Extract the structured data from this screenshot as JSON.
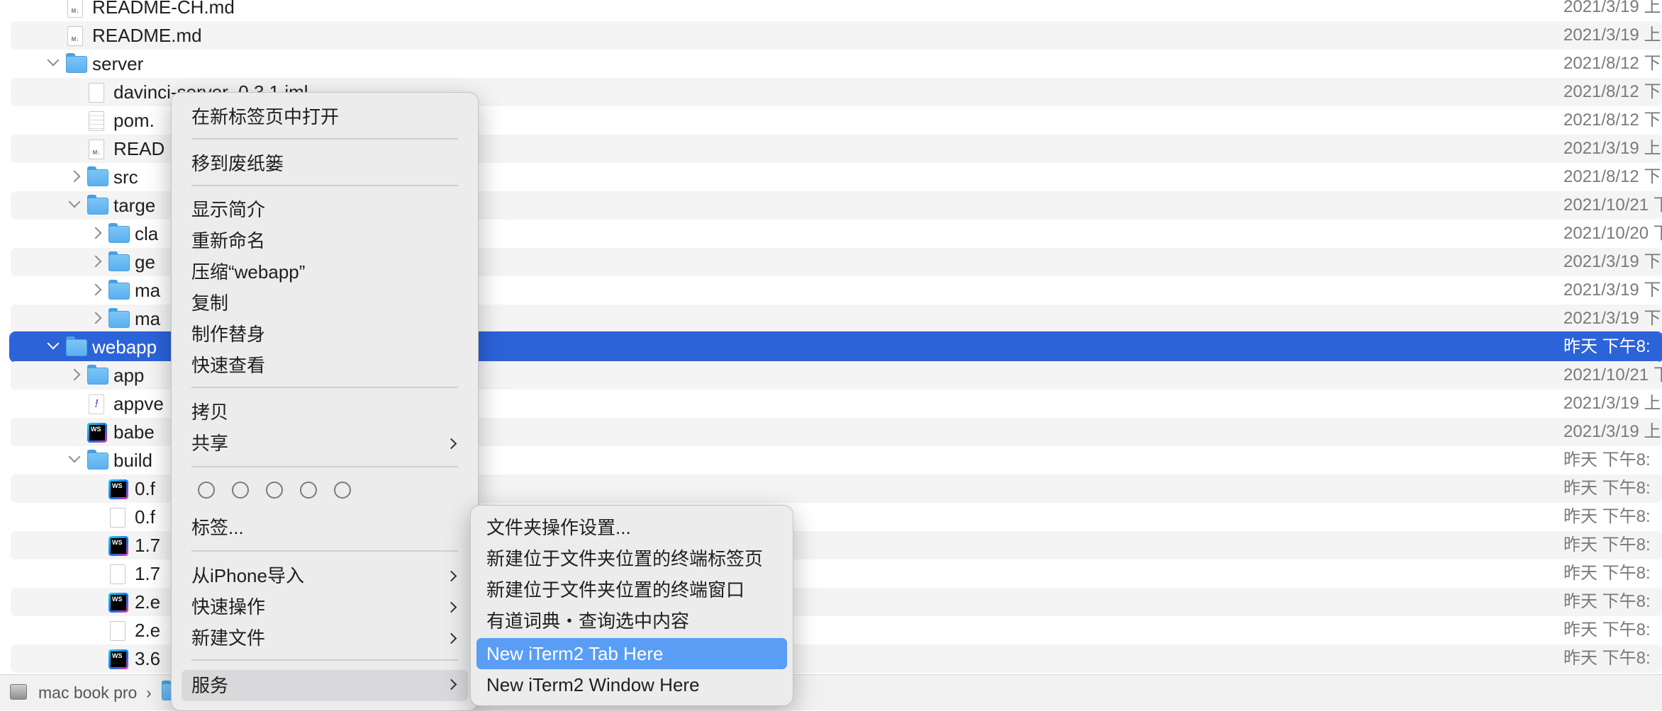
{
  "file_rows": [
    {
      "name": "README-CH.md",
      "date": "2021/3/19 上",
      "icon": "markdown-file-icon",
      "indent": 0,
      "chevron": "none",
      "alt": false,
      "selected": false
    },
    {
      "name": "README.md",
      "date": "2021/3/19 上",
      "icon": "markdown-file-icon",
      "indent": 0,
      "chevron": "none",
      "alt": true,
      "selected": false
    },
    {
      "name": "server",
      "date": "2021/8/12 下",
      "icon": "folder-icon",
      "indent": 0,
      "chevron": "down",
      "alt": false,
      "selected": false
    },
    {
      "name": "davinci-server_0.3.1.iml",
      "date": "2021/8/12 下",
      "icon": "document-icon",
      "indent": 1,
      "chevron": "none",
      "alt": true,
      "selected": false
    },
    {
      "name": "pom.",
      "date": "2021/8/12 下",
      "icon": "xml-document-icon",
      "indent": 1,
      "chevron": "none",
      "alt": false,
      "selected": false
    },
    {
      "name": "READ",
      "date": "2021/3/19 上",
      "icon": "markdown-file-icon",
      "indent": 1,
      "chevron": "none",
      "alt": true,
      "selected": false
    },
    {
      "name": "src",
      "date": "2021/8/12 下",
      "icon": "folder-icon",
      "indent": 1,
      "chevron": "right",
      "alt": false,
      "selected": false
    },
    {
      "name": "targe",
      "date": "2021/10/21 下",
      "icon": "folder-icon",
      "indent": 1,
      "chevron": "down",
      "alt": true,
      "selected": false
    },
    {
      "name": "cla",
      "date": "2021/10/20 下",
      "icon": "folder-icon",
      "indent": 2,
      "chevron": "right",
      "alt": false,
      "selected": false
    },
    {
      "name": "ge",
      "date": "2021/3/19 下",
      "icon": "folder-icon",
      "indent": 2,
      "chevron": "right",
      "alt": true,
      "selected": false
    },
    {
      "name": "ma",
      "date": "2021/3/19 下",
      "icon": "folder-icon",
      "indent": 2,
      "chevron": "right",
      "alt": false,
      "selected": false
    },
    {
      "name": "ma",
      "date": "2021/3/19 下",
      "icon": "folder-icon",
      "indent": 2,
      "chevron": "right",
      "alt": true,
      "selected": false
    },
    {
      "name": "webapp",
      "date": "昨天 下午8:",
      "icon": "folder-icon",
      "indent": 0,
      "chevron": "down",
      "alt": false,
      "selected": true
    },
    {
      "name": "app",
      "date": "2021/10/21 下",
      "icon": "folder-icon",
      "indent": 1,
      "chevron": "right",
      "alt": true,
      "selected": false
    },
    {
      "name": "appve",
      "date": "2021/3/19 上",
      "icon": "yml-file-icon",
      "indent": 1,
      "chevron": "none",
      "alt": false,
      "selected": false
    },
    {
      "name": "babe",
      "date": "2021/3/19 上",
      "icon": "webstorm-file-icon",
      "indent": 1,
      "chevron": "none",
      "alt": true,
      "selected": false
    },
    {
      "name": "build",
      "date": "昨天 下午8:",
      "icon": "folder-icon",
      "indent": 1,
      "chevron": "down",
      "alt": false,
      "selected": false
    },
    {
      "name": "0.f",
      "date": "昨天 下午8:",
      "icon": "webstorm-file-icon",
      "indent": 2,
      "chevron": "none",
      "alt": true,
      "selected": false
    },
    {
      "name": "0.f",
      "date": "昨天 下午8:",
      "icon": "document-icon",
      "indent": 2,
      "chevron": "none",
      "alt": false,
      "selected": false
    },
    {
      "name": "1.7",
      "date": "昨天 下午8:",
      "icon": "webstorm-file-icon",
      "indent": 2,
      "chevron": "none",
      "alt": true,
      "selected": false
    },
    {
      "name": "1.7",
      "date": "昨天 下午8:",
      "icon": "document-icon",
      "indent": 2,
      "chevron": "none",
      "alt": false,
      "selected": false
    },
    {
      "name": "2.e",
      "date": "昨天 下午8:",
      "icon": "webstorm-file-icon",
      "indent": 2,
      "chevron": "none",
      "alt": true,
      "selected": false
    },
    {
      "name": "2.e",
      "date": "昨天 下午8:",
      "icon": "document-icon",
      "indent": 2,
      "chevron": "none",
      "alt": false,
      "selected": false
    },
    {
      "name": "3.6",
      "date": "昨天 下午8:",
      "icon": "webstorm-file-icon",
      "indent": 2,
      "chevron": "none",
      "alt": true,
      "selected": false
    }
  ],
  "path_bar": {
    "drive_label": "mac book pro",
    "separator": "›"
  },
  "context_menu": {
    "open_new_tab": "在新标签页中打开",
    "move_to_trash": "移到废纸篓",
    "get_info": "显示简介",
    "rename": "重新命名",
    "compress": "压缩“webapp”",
    "duplicate": "复制",
    "make_alias": "制作替身",
    "quick_look": "快速查看",
    "copy": "拷贝",
    "share": "共享",
    "tag_colors": [
      "#7b7b7b",
      "#7b7b7b",
      "#7b7b7b",
      "#7b7b7b",
      "#7b7b7b"
    ],
    "tags": "标签...",
    "import_from_iphone": "从iPhone导入",
    "quick_actions": "快速操作",
    "new_file": "新建文件",
    "services": "服务"
  },
  "services_menu": {
    "folder_actions_setup": "文件夹操作设置...",
    "new_terminal_tab": "新建位于文件夹位置的终端标签页",
    "new_terminal_window": "新建位于文件夹位置的终端窗口",
    "youdao_lookup": "有道词典・查询选中内容",
    "new_iterm2_tab": "New iTerm2 Tab Here",
    "new_iterm2_window": "New iTerm2 Window Here"
  }
}
